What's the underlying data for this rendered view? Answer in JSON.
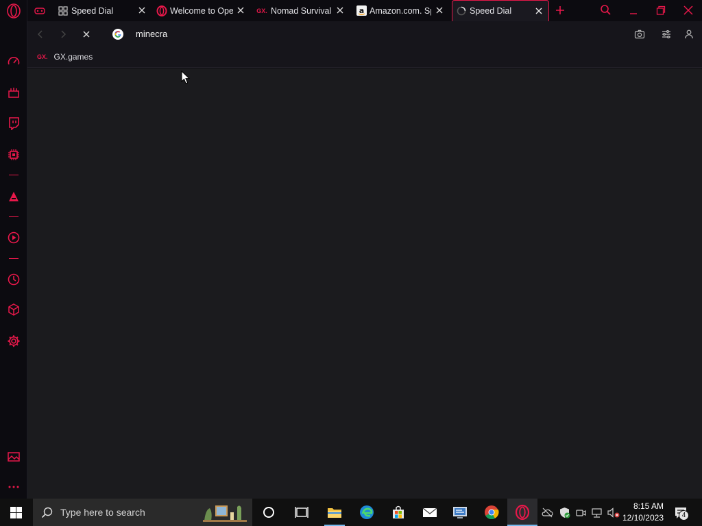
{
  "tabs": [
    {
      "title": "Speed Dial",
      "icon": "speed-dial-grid-icon"
    },
    {
      "title": "Welcome to Ope",
      "icon": "opera-logo-icon"
    },
    {
      "title": "Nomad Survival",
      "icon": "gx-logo-icon"
    },
    {
      "title": "Amazon.com. Sp",
      "icon": "amazon-logo-icon"
    },
    {
      "title": "Speed Dial",
      "icon": "loading-spinner-icon"
    }
  ],
  "address_bar": {
    "value": "minecra",
    "engine_icon": "google-g-icon"
  },
  "bookmarks": [
    {
      "badge": "GX.",
      "label": "GX.games"
    }
  ],
  "taskbar": {
    "search_placeholder": "Type here to search",
    "time": "8:15 AM",
    "date": "12/10/2023",
    "notification_count": "4"
  },
  "colors": {
    "accent": "#e8184a",
    "background": "#1b1b1e",
    "sidebar": "#0c0b10"
  }
}
